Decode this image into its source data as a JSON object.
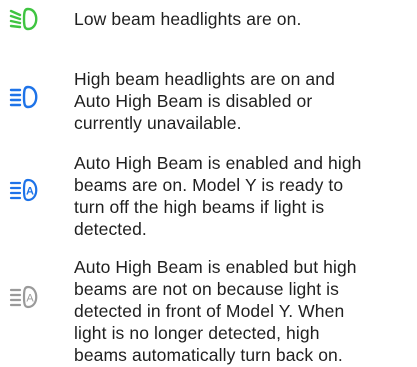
{
  "items": [
    {
      "icon": "low-beam-headlight-icon",
      "color": "#3fc441",
      "lines": [
        "Low beam headlights are on."
      ]
    },
    {
      "icon": "high-beam-headlight-icon",
      "color": "#1e73e8",
      "lines": [
        "High beam headlights are on and",
        "Auto High Beam is disabled or",
        "currently unavailable."
      ]
    },
    {
      "icon": "auto-high-beam-active-icon",
      "color": "#1e73e8",
      "lines": [
        "Auto High Beam is enabled and high",
        "beams are on. Model Y is ready to",
        "turn off the high beams if light is",
        "detected."
      ]
    },
    {
      "icon": "auto-high-beam-standby-icon",
      "color": "#9a9a9a",
      "lines": [
        "Auto High Beam is enabled but high",
        "beams are not on because light is",
        "detected in front of Model Y. When",
        "light is no longer detected, high",
        "beams automatically turn back on."
      ]
    }
  ]
}
